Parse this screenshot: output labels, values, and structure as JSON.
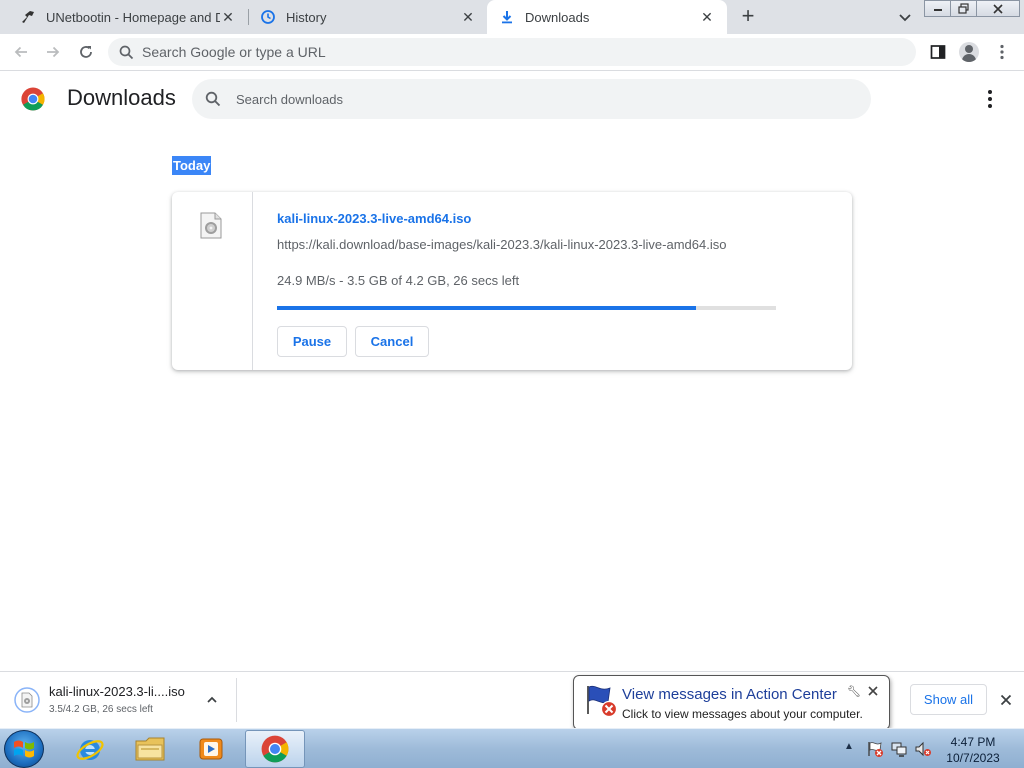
{
  "tabs": [
    {
      "label": "UNetbootin - Homepage and Do",
      "icon": "unetbootin-icon"
    },
    {
      "label": "History",
      "icon": "history-icon"
    },
    {
      "label": "Downloads",
      "icon": "download-icon"
    }
  ],
  "omnibox": {
    "placeholder": "Search Google or type a URL"
  },
  "page": {
    "title": "Downloads",
    "search_placeholder": "Search downloads",
    "date_heading": "Today"
  },
  "download": {
    "filename": "kali-linux-2023.3-live-amd64.iso",
    "url": "https://kali.download/base-images/kali-2023.3/kali-linux-2023.3-live-amd64.iso",
    "status": "24.9 MB/s - 3.5 GB of 4.2 GB, 26 secs left",
    "progress": 0.84,
    "pause_label": "Pause",
    "cancel_label": "Cancel"
  },
  "shelf": {
    "filename": "kali-linux-2023.3-li....iso",
    "status": "3.5/4.2 GB, 26 secs left",
    "show_all_label": "Show all"
  },
  "notification": {
    "title": "View messages in Action Center",
    "text": "Click to view messages about your computer."
  },
  "clock": {
    "time": "4:47 PM",
    "date": "10/7/2023"
  },
  "colors": {
    "accent": "#1a73e8",
    "selection": "#3b86f7",
    "tabstrip": "#dee1e6"
  }
}
